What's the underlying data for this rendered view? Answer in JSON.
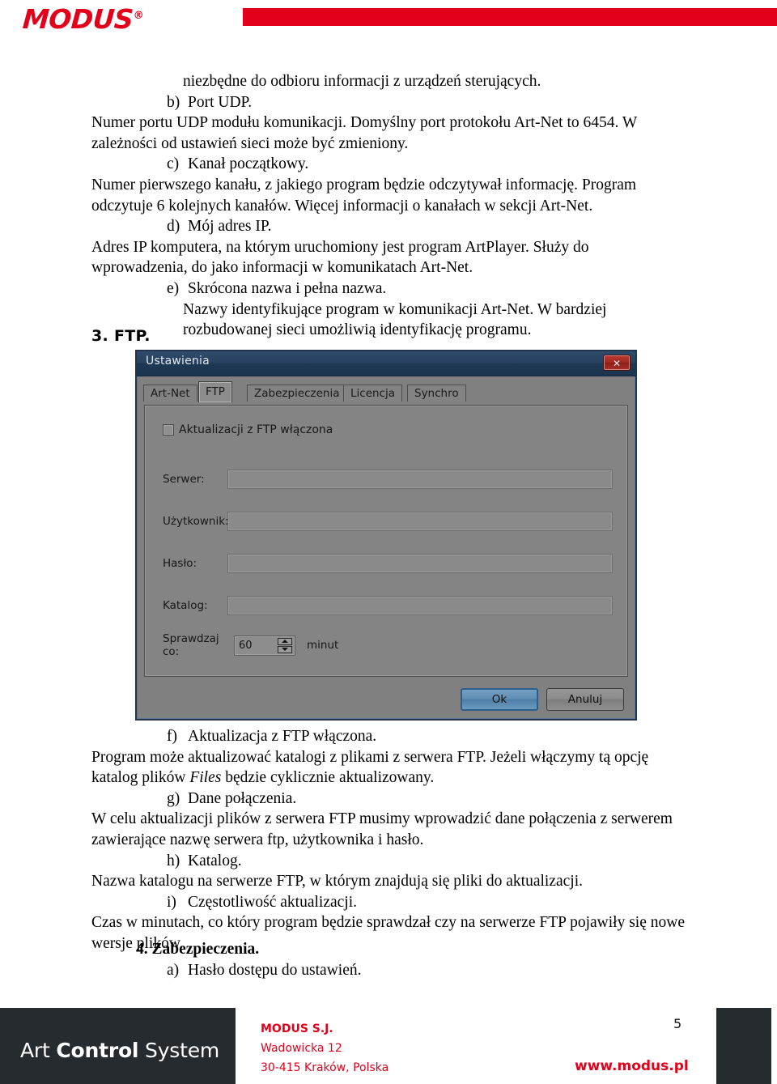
{
  "header": {
    "logo_text": "MODUS",
    "logo_reg": "®"
  },
  "document": {
    "paragraphs": [
      {
        "id": "p-intro-cont",
        "indent": 3,
        "text": "niezbędne do odbioru informacji z urządzeń sterujących."
      },
      {
        "id": "p-b-label",
        "indent": 2,
        "label": "b)",
        "text": "Port UDP."
      },
      {
        "id": "p-b-body",
        "indent": 1,
        "text": "Numer portu UDP modułu komunikacji. Domyślny port protokołu Art-Net to 6454. W zależności od ustawień sieci może być zmieniony."
      },
      {
        "id": "p-c-label",
        "indent": 2,
        "label": "c)",
        "text": "Kanał początkowy."
      },
      {
        "id": "p-c-body",
        "indent": 1,
        "text": "Numer pierwszego kanału, z jakiego program będzie odczytywał informację. Program odczytuje 6 kolejnych kanałów. Więcej informacji o kanałach w sekcji Art-Net."
      },
      {
        "id": "p-d-label",
        "indent": 2,
        "label": "d)",
        "text": "Mój adres IP."
      },
      {
        "id": "p-d-body",
        "indent": 1,
        "text": "Adres IP komputera, na którym uruchomiony jest program ArtPlayer. Służy do wprowadzenia, do jako informacji w komunikatach Art-Net."
      },
      {
        "id": "p-e-label",
        "indent": 2,
        "label": "e)",
        "text": "Skrócona nazwa i pełna nazwa."
      },
      {
        "id": "p-e-body",
        "indent": 3,
        "text": "Nazwy identyfikujące program w komunikacji Art-Net. W bardziej rozbudowanej sieci umożliwią identyfikację programu."
      }
    ],
    "section_3_heading": "3.  FTP.",
    "paragraphs_after": [
      {
        "id": "p-f-label",
        "indent": 2,
        "label": "f)",
        "text": "Aktualizacja z FTP włączona."
      },
      {
        "id": "p-f-body-1",
        "indent": 1,
        "text": "Program może aktualizować katalogi z plikami z serwera FTP. Jeżeli włączymy tą opcję katalog plików "
      },
      {
        "id": "p-f-body-italic",
        "indent": 0,
        "text": "Files"
      },
      {
        "id": "p-f-body-2",
        "indent": 0,
        "text": " będzie cyklicznie aktualizowany."
      },
      {
        "id": "p-g-label",
        "indent": 2,
        "label": "g)",
        "text": "Dane połączenia."
      },
      {
        "id": "p-g-body",
        "indent": 1,
        "text": "W celu aktualizacji plików z serwera FTP musimy wprowadzić dane połączenia z serwerem zawierające nazwę serwera ftp, użytkownika i hasło."
      },
      {
        "id": "p-h-label",
        "indent": 2,
        "label": "h)",
        "text": "Katalog."
      },
      {
        "id": "p-h-body",
        "indent": 1,
        "text": "Nazwa katalogu na serwerze FTP, w którym znajdują się pliki do aktualizacji."
      },
      {
        "id": "p-i-label",
        "indent": 2,
        "label": "i)",
        "text": "Częstotliwość aktualizacji."
      },
      {
        "id": "p-i-body",
        "indent": 1,
        "text": "Czas w minutach, co który program będzie sprawdzał czy na serwerze FTP pojawiły się nowe wersje plików."
      }
    ],
    "section_4_heading": "4.  Zabezpieczenia.",
    "section_4_item_a_label": "a)",
    "section_4_item_a_text": "Hasło dostępu do ustawień."
  },
  "dialog": {
    "title": "Ustawienia",
    "close_label": "✕",
    "tabs": [
      {
        "label": "Art-Net",
        "active": false
      },
      {
        "label": "FTP",
        "active": true
      },
      {
        "label": "Zabezpieczenia",
        "active": false
      },
      {
        "label": "Licencja",
        "active": false
      },
      {
        "label": "Synchro",
        "active": false
      }
    ],
    "checkbox": {
      "label": "Aktualizacji z FTP włączona",
      "checked": false
    },
    "fields": [
      {
        "label": "Serwer:",
        "value": ""
      },
      {
        "label": "Użytkownik:",
        "value": ""
      },
      {
        "label": "Hasło:",
        "value": ""
      },
      {
        "label": "Katalog:",
        "value": ""
      }
    ],
    "interval": {
      "label": "Sprawdzaj co:",
      "value": "60",
      "unit": "minut"
    },
    "buttons": {
      "ok": "Ok",
      "cancel": "Anuluj"
    },
    "colors": {
      "titlebar": "#27415e",
      "panel": "#848484",
      "close": "#a02a22",
      "ok": "#5f8db3"
    }
  },
  "footer": {
    "brand_pre": "Art ",
    "brand_mid": "Control",
    "brand_post": " System",
    "company": "MODUS S.J.",
    "street": "Wadowicka 12",
    "city": "30-415 Kraków, Polska",
    "website": "www.modus.pl",
    "page_number": "5",
    "accent": "#e2001a"
  }
}
